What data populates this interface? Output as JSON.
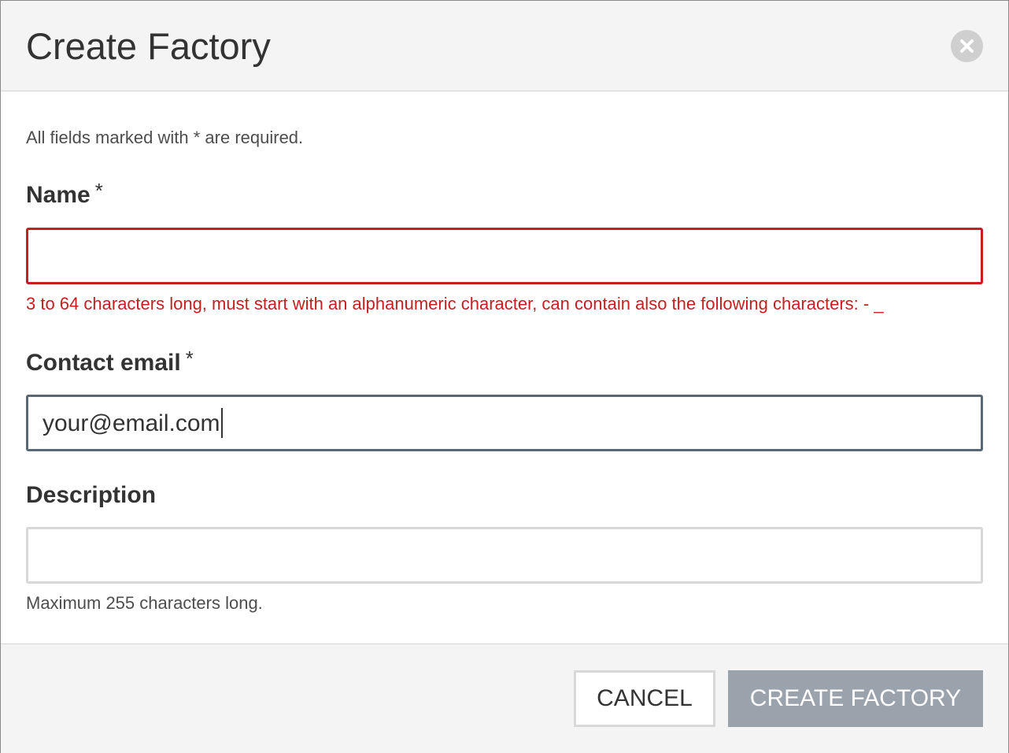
{
  "dialog": {
    "title": "Create Factory",
    "close_icon": "close-icon"
  },
  "form": {
    "required_note": "All fields marked with * are required.",
    "required_marker": "*",
    "name": {
      "label": "Name",
      "value": "",
      "error": "3 to 64 characters long, must start with an alphanumeric character, can contain also the following characters: - _"
    },
    "email": {
      "label": "Contact email",
      "value": "your@email.com"
    },
    "description": {
      "label": "Description",
      "value": "",
      "help": "Maximum 255 characters long."
    }
  },
  "footer": {
    "cancel_label": "CANCEL",
    "create_label": "CREATE FACTORY"
  },
  "colors": {
    "error": "#c51f1f",
    "focus_border": "#586874",
    "primary_disabled": "#9aa2ac",
    "header_bg": "#f4f4f4"
  }
}
